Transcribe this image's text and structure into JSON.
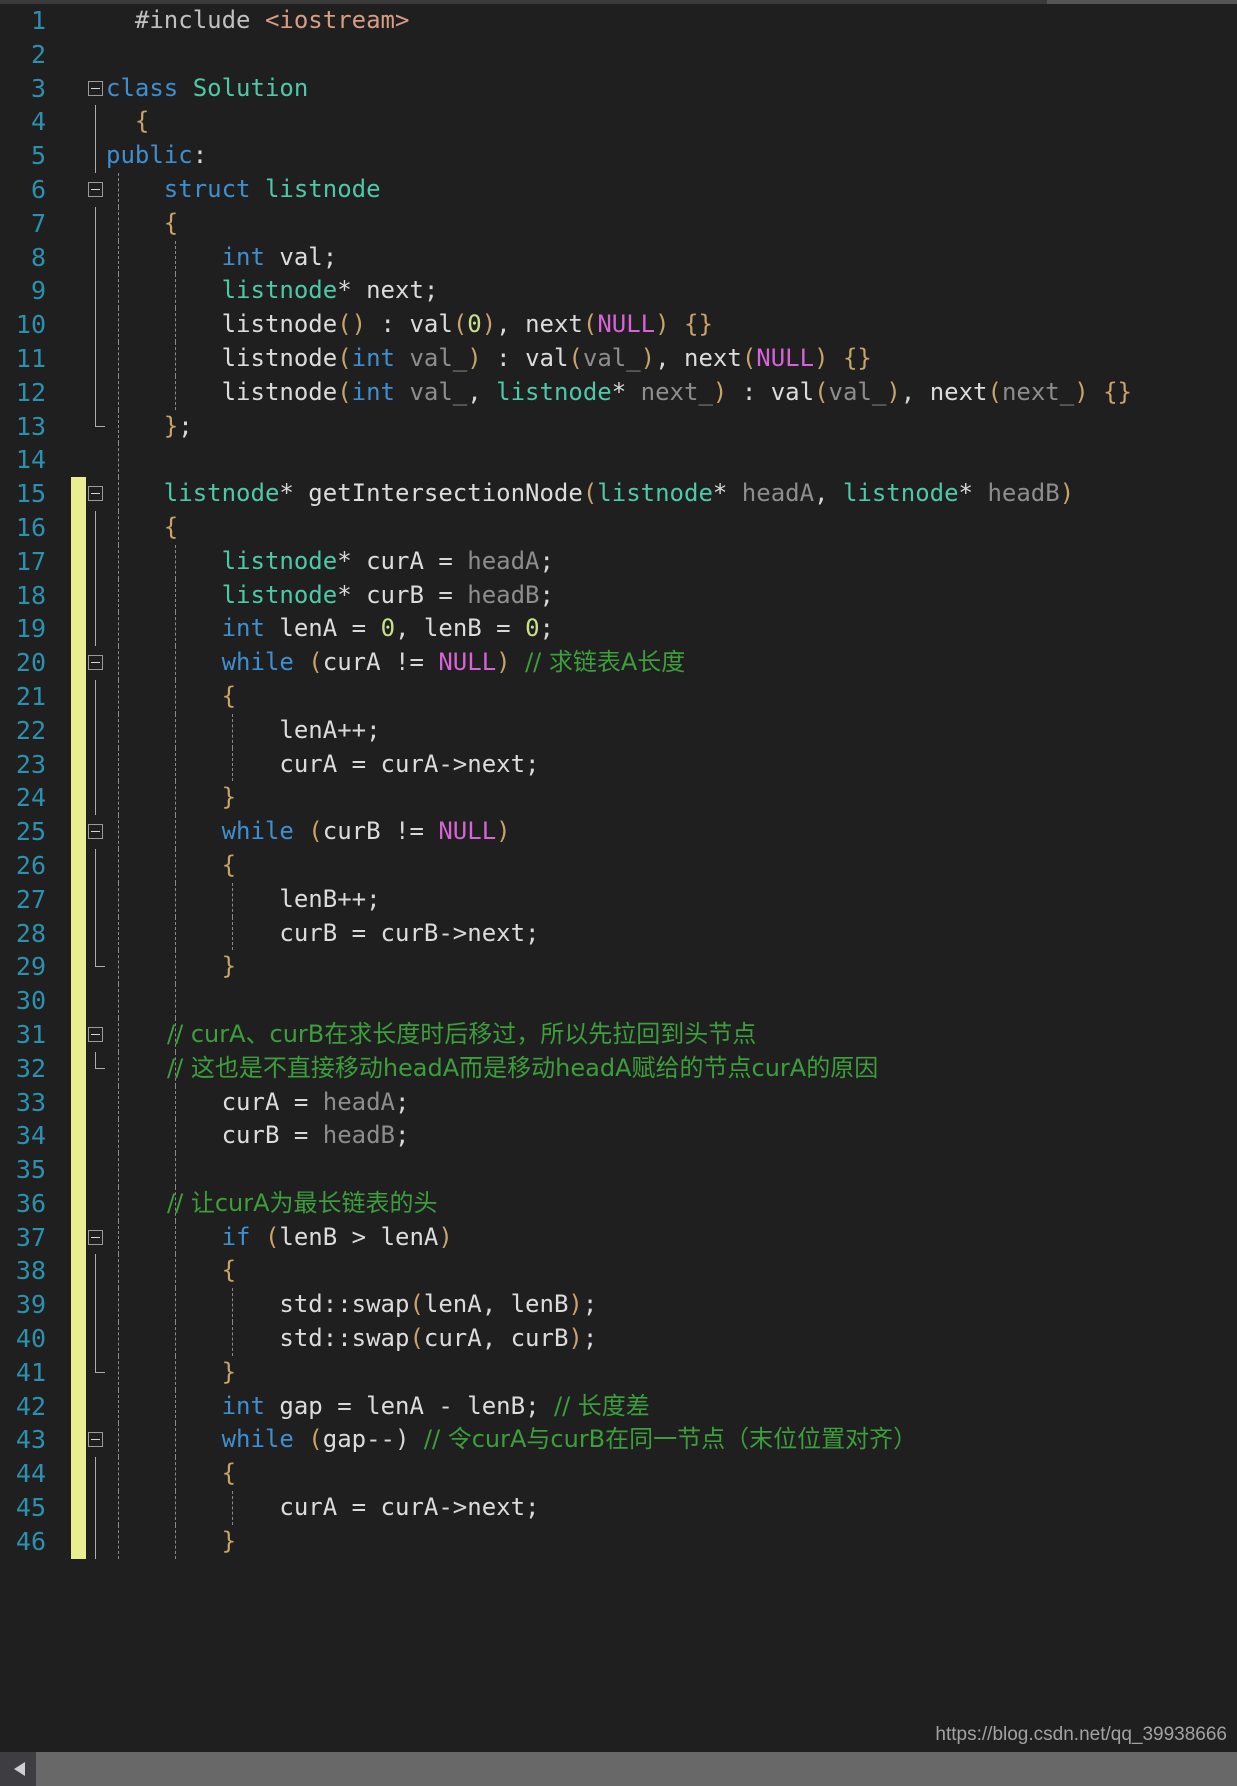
{
  "editor": {
    "language": "cpp",
    "theme": "dark",
    "background_color": "#1f1f1f",
    "line_number_color": "#2b91af",
    "change_bar_color": "#eaee92",
    "watermark": "https://blog.csdn.net/qq_39938666",
    "scrollbar": {
      "orientation": "horizontal",
      "left_arrow": "◀"
    }
  },
  "colors": {
    "keyword": "#3f8fd0",
    "type": "#4ec9a8",
    "comment": "#3c9e3c",
    "null_macro": "#d664d6",
    "number": "#c6e08b",
    "parameter": "#8d8d8d",
    "string": "#d69d85",
    "plain": "#d4d4d4"
  },
  "lines": [
    {
      "n": "1",
      "fold": false,
      "changed": false,
      "text": "    #include <iostream>"
    },
    {
      "n": "2",
      "fold": false,
      "changed": false,
      "text": ""
    },
    {
      "n": "3",
      "fold": true,
      "changed": false,
      "text": "class Solution"
    },
    {
      "n": "4",
      "fold": false,
      "changed": false,
      "text": "{"
    },
    {
      "n": "5",
      "fold": false,
      "changed": false,
      "text": "public:"
    },
    {
      "n": "6",
      "fold": true,
      "changed": false,
      "text": "    struct listnode"
    },
    {
      "n": "7",
      "fold": false,
      "changed": false,
      "text": "    {"
    },
    {
      "n": "8",
      "fold": false,
      "changed": false,
      "text": "        int val;"
    },
    {
      "n": "9",
      "fold": false,
      "changed": false,
      "text": "        listnode* next;"
    },
    {
      "n": "10",
      "fold": false,
      "changed": false,
      "text": "        listnode() : val(0), next(NULL) {}"
    },
    {
      "n": "11",
      "fold": false,
      "changed": false,
      "text": "        listnode(int val_) : val(val_), next(NULL) {}"
    },
    {
      "n": "12",
      "fold": false,
      "changed": false,
      "text": "        listnode(int val_, listnode* next_) : val(val_), next(next_) {}"
    },
    {
      "n": "13",
      "fold": false,
      "changed": false,
      "text": "    };"
    },
    {
      "n": "14",
      "fold": false,
      "changed": false,
      "text": ""
    },
    {
      "n": "15",
      "fold": true,
      "changed": true,
      "text": "    listnode* getIntersectionNode(listnode* headA, listnode* headB)"
    },
    {
      "n": "16",
      "fold": false,
      "changed": true,
      "text": "    {"
    },
    {
      "n": "17",
      "fold": false,
      "changed": true,
      "text": "        listnode* curA = headA;"
    },
    {
      "n": "18",
      "fold": false,
      "changed": true,
      "text": "        listnode* curB = headB;"
    },
    {
      "n": "19",
      "fold": false,
      "changed": true,
      "text": "        int lenA = 0, lenB = 0;"
    },
    {
      "n": "20",
      "fold": true,
      "changed": true,
      "text": "        while (curA != NULL) // 求链表A长度"
    },
    {
      "n": "21",
      "fold": false,
      "changed": true,
      "text": "        {"
    },
    {
      "n": "22",
      "fold": false,
      "changed": true,
      "text": "            lenA++;"
    },
    {
      "n": "23",
      "fold": false,
      "changed": true,
      "text": "            curA = curA->next;"
    },
    {
      "n": "24",
      "fold": false,
      "changed": true,
      "text": "        }"
    },
    {
      "n": "25",
      "fold": true,
      "changed": true,
      "text": "        while (curB != NULL)"
    },
    {
      "n": "26",
      "fold": false,
      "changed": true,
      "text": "        {"
    },
    {
      "n": "27",
      "fold": false,
      "changed": true,
      "text": "            lenB++;"
    },
    {
      "n": "28",
      "fold": false,
      "changed": true,
      "text": "            curB = curB->next;"
    },
    {
      "n": "29",
      "fold": false,
      "changed": true,
      "text": "        }"
    },
    {
      "n": "30",
      "fold": false,
      "changed": true,
      "text": ""
    },
    {
      "n": "31",
      "fold": true,
      "changed": true,
      "text": "        // curA、curB在求长度时后移过，所以先拉回到头节点"
    },
    {
      "n": "32",
      "fold": false,
      "changed": true,
      "text": "        // 这也是不直接移动headA而是移动headA赋给的节点curA的原因"
    },
    {
      "n": "33",
      "fold": false,
      "changed": true,
      "text": "        curA = headA;"
    },
    {
      "n": "34",
      "fold": false,
      "changed": true,
      "text": "        curB = headB;"
    },
    {
      "n": "35",
      "fold": false,
      "changed": true,
      "text": ""
    },
    {
      "n": "36",
      "fold": false,
      "changed": true,
      "text": "        // 让curA为最长链表的头"
    },
    {
      "n": "37",
      "fold": true,
      "changed": true,
      "text": "        if (lenB > lenA)"
    },
    {
      "n": "38",
      "fold": false,
      "changed": true,
      "text": "        {"
    },
    {
      "n": "39",
      "fold": false,
      "changed": true,
      "text": "            std::swap(lenA, lenB);"
    },
    {
      "n": "40",
      "fold": false,
      "changed": true,
      "text": "            std::swap(curA, curB);"
    },
    {
      "n": "41",
      "fold": false,
      "changed": true,
      "text": "        }"
    },
    {
      "n": "42",
      "fold": false,
      "changed": true,
      "text": "        int gap = lenA - lenB; // 长度差"
    },
    {
      "n": "43",
      "fold": true,
      "changed": true,
      "text": "        while (gap--) // 令curA与curB在同一节点（末位位置对齐）"
    },
    {
      "n": "44",
      "fold": false,
      "changed": true,
      "text": "        {"
    },
    {
      "n": "45",
      "fold": false,
      "changed": true,
      "text": "            curA = curA->next;"
    },
    {
      "n": "46",
      "fold": false,
      "changed": true,
      "text": "        }"
    }
  ]
}
